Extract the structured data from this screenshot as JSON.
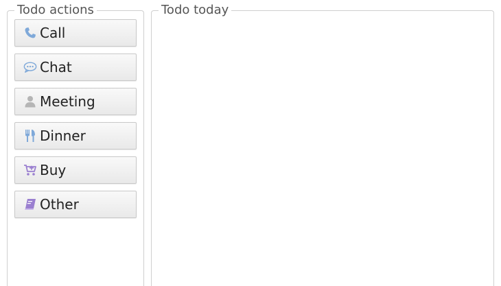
{
  "todo_actions": {
    "legend": "Todo actions",
    "buttons": [
      {
        "label": "Call",
        "icon": "phone-icon"
      },
      {
        "label": "Chat",
        "icon": "speech-bubble-icon"
      },
      {
        "label": "Meeting",
        "icon": "person-icon"
      },
      {
        "label": "Dinner",
        "icon": "fork-knife-icon"
      },
      {
        "label": "Buy",
        "icon": "cart-icon"
      },
      {
        "label": "Other",
        "icon": "book-icon"
      }
    ]
  },
  "todo_today": {
    "legend": "Todo today"
  },
  "colors": {
    "icon_blue": "#7fa9d9",
    "icon_gray": "#b5b5b5",
    "icon_purple": "#9a7fd0"
  }
}
